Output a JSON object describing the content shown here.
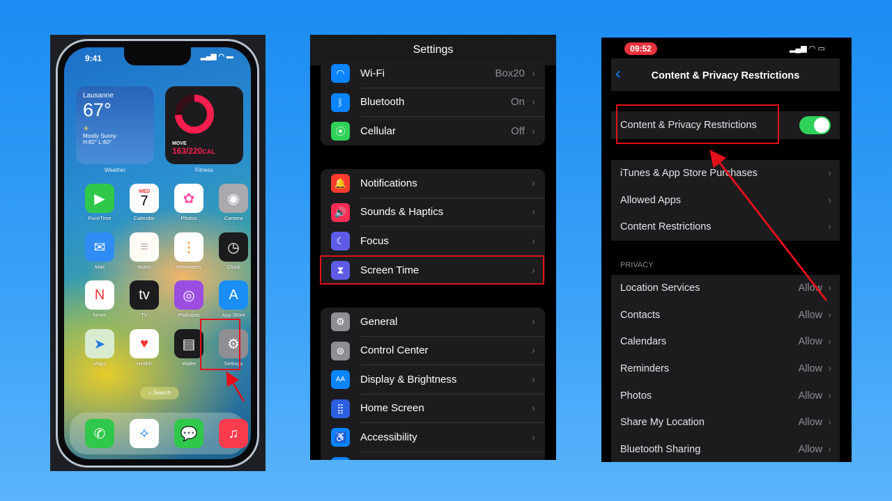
{
  "home_screen": {
    "status_time": "9:41",
    "weather": {
      "city": "Lausanne",
      "temp": "67°",
      "condition": "Mostly Sunny",
      "range": "H:82° L:60°",
      "label": "Weather"
    },
    "fitness": {
      "move_label": "MOVE",
      "move_value": "163/220",
      "move_unit": "CAL",
      "label": "Fitness",
      "progress": 0.74
    },
    "apps": [
      {
        "label": "FaceTime",
        "icon": "video-camera-icon",
        "color": "#30c84a",
        "glyph": "▶"
      },
      {
        "label": "Calendar",
        "icon": "calendar-icon",
        "color": "#ffffff",
        "day": "WED",
        "date": "7"
      },
      {
        "label": "Photos",
        "icon": "photos-flower-icon",
        "color": "#ffffff",
        "glyph": "✿"
      },
      {
        "label": "Camera",
        "icon": "camera-icon",
        "color": "#a9a9ae",
        "glyph": "◉"
      },
      {
        "label": "Mail",
        "icon": "envelope-icon",
        "color": "#2f8cf5",
        "glyph": "✉"
      },
      {
        "label": "Notes",
        "icon": "notes-icon",
        "color": "#fdfcf5",
        "glyph": "≡"
      },
      {
        "label": "Reminders",
        "icon": "reminders-list-icon",
        "color": "#ffffff",
        "glyph": "⋮"
      },
      {
        "label": "Clock",
        "icon": "clock-icon",
        "color": "#1c1c1e",
        "glyph": "◷"
      },
      {
        "label": "News",
        "icon": "news-icon",
        "color": "#ffffff",
        "glyph": "N"
      },
      {
        "label": "TV",
        "icon": "apple-tv-icon",
        "color": "#1c1c1e",
        "glyph": "tv"
      },
      {
        "label": "Podcasts",
        "icon": "podcasts-icon",
        "color": "#9b4de0",
        "glyph": "◎"
      },
      {
        "label": "App Store",
        "icon": "app-store-icon",
        "color": "#1b8ef5",
        "glyph": "A"
      },
      {
        "label": "Maps",
        "icon": "maps-icon",
        "color": "#d8ecd0",
        "glyph": "➤"
      },
      {
        "label": "Health",
        "icon": "heart-icon",
        "color": "#ffffff",
        "glyph": "♥"
      },
      {
        "label": "Wallet",
        "icon": "wallet-icon",
        "color": "#1c1c1e",
        "glyph": "▤"
      },
      {
        "label": "Settings",
        "icon": "gear-icon",
        "color": "#8e8e93",
        "glyph": "⚙"
      }
    ],
    "search_label": "Search",
    "dock": [
      {
        "icon": "phone-icon",
        "color": "#30c84a",
        "glyph": "✆"
      },
      {
        "icon": "safari-compass-icon",
        "color": "#ffffff",
        "glyph": "✧"
      },
      {
        "icon": "messages-icon",
        "color": "#30c84a",
        "glyph": "💬"
      },
      {
        "icon": "music-note-icon",
        "color": "#fa3c4c",
        "glyph": "♫"
      }
    ]
  },
  "settings": {
    "title": "Settings",
    "groups": [
      [
        {
          "label": "Wi-Fi",
          "value": "Box20",
          "icon": "wifi-icon",
          "color": "#0a84ff",
          "glyph": "◠"
        },
        {
          "label": "Bluetooth",
          "value": "On",
          "icon": "bluetooth-icon",
          "color": "#0a84ff",
          "glyph": "ᛒ"
        },
        {
          "label": "Cellular",
          "value": "Off",
          "icon": "antenna-icon",
          "color": "#30d158",
          "glyph": "⦿"
        }
      ],
      [
        {
          "label": "Notifications",
          "value": "",
          "icon": "bell-icon",
          "color": "#ff3b30",
          "glyph": "🔔"
        },
        {
          "label": "Sounds & Haptics",
          "value": "",
          "icon": "speaker-icon",
          "color": "#ff2d55",
          "glyph": "🔊"
        },
        {
          "label": "Focus",
          "value": "",
          "icon": "moon-icon",
          "color": "#5e5ce6",
          "glyph": "☾"
        },
        {
          "label": "Screen Time",
          "value": "",
          "icon": "hourglass-icon",
          "color": "#5e5ce6",
          "glyph": "⧗"
        }
      ],
      [
        {
          "label": "General",
          "value": "",
          "icon": "gear-icon",
          "color": "#8e8e93",
          "glyph": "⚙"
        },
        {
          "label": "Control Center",
          "value": "",
          "icon": "toggles-icon",
          "color": "#8e8e93",
          "glyph": "⊜"
        },
        {
          "label": "Display & Brightness",
          "value": "",
          "icon": "text-size-icon",
          "color": "#0a84ff",
          "glyph": "AA"
        },
        {
          "label": "Home Screen",
          "value": "",
          "icon": "app-grid-icon",
          "color": "#2c5fe0",
          "glyph": "⣿"
        },
        {
          "label": "Accessibility",
          "value": "",
          "icon": "accessibility-icon",
          "color": "#0a84ff",
          "glyph": "♿"
        }
      ]
    ]
  },
  "restrictions": {
    "status_time": "09:52",
    "title": "Content & Privacy Restrictions",
    "toggle": {
      "label": "Content & Privacy Restrictions",
      "on": true,
      "color": "#30d158"
    },
    "items": [
      "iTunes & App Store Purchases",
      "Allowed Apps",
      "Content Restrictions"
    ],
    "privacy_header": "PRIVACY",
    "privacy": [
      {
        "label": "Location Services",
        "value": "Allow"
      },
      {
        "label": "Contacts",
        "value": "Allow"
      },
      {
        "label": "Calendars",
        "value": "Allow"
      },
      {
        "label": "Reminders",
        "value": "Allow"
      },
      {
        "label": "Photos",
        "value": "Allow"
      },
      {
        "label": "Share My Location",
        "value": "Allow"
      },
      {
        "label": "Bluetooth Sharing",
        "value": "Allow"
      }
    ]
  },
  "annotation_color": "#e3101a"
}
